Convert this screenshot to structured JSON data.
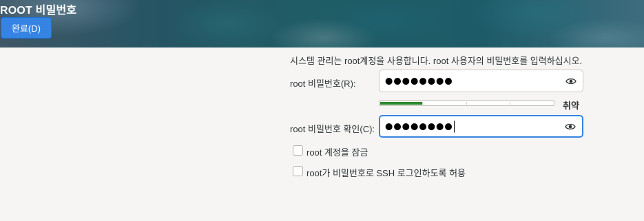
{
  "header": {
    "title": "ROOT 비밀번호",
    "done_button": "완료(D)"
  },
  "main": {
    "description": "시스템 관리는 root계정을 사용합니다. root 사용자의 비밀번호를 입력하십시오.",
    "password": {
      "label": "root 비밀번호(R):",
      "value_masked": "●●●●●●●●",
      "reveal_icon": "eye-icon"
    },
    "strength": {
      "level": 0.25,
      "label": "취약",
      "color": "#2b8a2b"
    },
    "confirm": {
      "label": "root 비밀번호 확인(C):",
      "value_masked": "●●●●●●●●",
      "reveal_icon": "eye-icon"
    },
    "options": [
      {
        "label": "root 계정을 잠금",
        "checked": false
      },
      {
        "label": "root가 비밀번호로 SSH 로그인하도록 허용",
        "checked": false
      }
    ]
  },
  "colors": {
    "accent": "#3584e4",
    "background": "#f6f5f4"
  }
}
